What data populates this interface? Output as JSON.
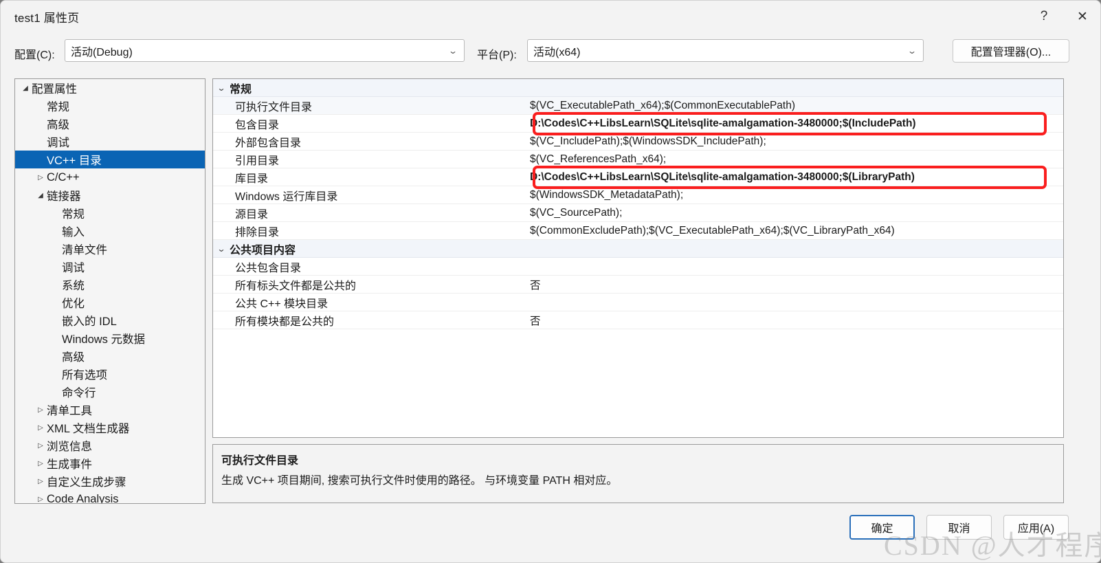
{
  "window": {
    "title": "test1 属性页",
    "help_icon": "?",
    "close_icon": "✕"
  },
  "config_bar": {
    "config_label": "配置(C):",
    "config_value": "活动(Debug)",
    "platform_label": "平台(P):",
    "platform_value": "活动(x64)",
    "config_manager_label": "配置管理器(O)...",
    "chevron": "⌄"
  },
  "tree": {
    "items": [
      {
        "label": "配置属性",
        "indent": 0,
        "twisty": "◢",
        "selected": false
      },
      {
        "label": "常规",
        "indent": 1,
        "twisty": "",
        "selected": false
      },
      {
        "label": "高级",
        "indent": 1,
        "twisty": "",
        "selected": false
      },
      {
        "label": "调试",
        "indent": 1,
        "twisty": "",
        "selected": false
      },
      {
        "label": "VC++ 目录",
        "indent": 1,
        "twisty": "",
        "selected": true
      },
      {
        "label": "C/C++",
        "indent": 1,
        "twisty": "▷",
        "selected": false
      },
      {
        "label": "链接器",
        "indent": 1,
        "twisty": "◢",
        "selected": false
      },
      {
        "label": "常规",
        "indent": 2,
        "twisty": "",
        "selected": false
      },
      {
        "label": "输入",
        "indent": 2,
        "twisty": "",
        "selected": false
      },
      {
        "label": "清单文件",
        "indent": 2,
        "twisty": "",
        "selected": false
      },
      {
        "label": "调试",
        "indent": 2,
        "twisty": "",
        "selected": false
      },
      {
        "label": "系统",
        "indent": 2,
        "twisty": "",
        "selected": false
      },
      {
        "label": "优化",
        "indent": 2,
        "twisty": "",
        "selected": false
      },
      {
        "label": "嵌入的 IDL",
        "indent": 2,
        "twisty": "",
        "selected": false
      },
      {
        "label": "Windows 元数据",
        "indent": 2,
        "twisty": "",
        "selected": false
      },
      {
        "label": "高级",
        "indent": 2,
        "twisty": "",
        "selected": false
      },
      {
        "label": "所有选项",
        "indent": 2,
        "twisty": "",
        "selected": false
      },
      {
        "label": "命令行",
        "indent": 2,
        "twisty": "",
        "selected": false
      },
      {
        "label": "清单工具",
        "indent": 1,
        "twisty": "▷",
        "selected": false
      },
      {
        "label": "XML 文档生成器",
        "indent": 1,
        "twisty": "▷",
        "selected": false
      },
      {
        "label": "浏览信息",
        "indent": 1,
        "twisty": "▷",
        "selected": false
      },
      {
        "label": "生成事件",
        "indent": 1,
        "twisty": "▷",
        "selected": false
      },
      {
        "label": "自定义生成步骤",
        "indent": 1,
        "twisty": "▷",
        "selected": false
      },
      {
        "label": "Code Analysis",
        "indent": 1,
        "twisty": "▷",
        "selected": false
      }
    ]
  },
  "grid": {
    "expander": "⌄",
    "rows": [
      {
        "kind": "category",
        "name": "常规",
        "value": ""
      },
      {
        "kind": "prop",
        "name": "可执行文件目录",
        "value": "$(VC_ExecutablePath_x64);$(CommonExecutablePath)",
        "alt": true,
        "bold": false,
        "highlight": false
      },
      {
        "kind": "prop",
        "name": "包含目录",
        "value": "D:\\Codes\\C++LibsLearn\\SQLite\\sqlite-amalgamation-3480000;$(IncludePath)",
        "alt": false,
        "bold": true,
        "highlight": true
      },
      {
        "kind": "prop",
        "name": "外部包含目录",
        "value": "$(VC_IncludePath);$(WindowsSDK_IncludePath);",
        "alt": false,
        "bold": false,
        "highlight": false
      },
      {
        "kind": "prop",
        "name": "引用目录",
        "value": "$(VC_ReferencesPath_x64);",
        "alt": false,
        "bold": false,
        "highlight": false
      },
      {
        "kind": "prop",
        "name": "库目录",
        "value": "D:\\Codes\\C++LibsLearn\\SQLite\\sqlite-amalgamation-3480000;$(LibraryPath)",
        "alt": false,
        "bold": true,
        "highlight": true
      },
      {
        "kind": "prop",
        "name": "Windows 运行库目录",
        "value": "$(WindowsSDK_MetadataPath);",
        "alt": false,
        "bold": false,
        "highlight": false
      },
      {
        "kind": "prop",
        "name": "源目录",
        "value": "$(VC_SourcePath);",
        "alt": false,
        "bold": false,
        "highlight": false
      },
      {
        "kind": "prop",
        "name": "排除目录",
        "value": "$(CommonExcludePath);$(VC_ExecutablePath_x64);$(VC_LibraryPath_x64)",
        "alt": false,
        "bold": false,
        "highlight": false
      },
      {
        "kind": "category",
        "name": "公共项目内容",
        "value": ""
      },
      {
        "kind": "prop",
        "name": "公共包含目录",
        "value": "",
        "alt": false,
        "bold": false,
        "highlight": false
      },
      {
        "kind": "prop",
        "name": "所有标头文件都是公共的",
        "value": "否",
        "alt": false,
        "bold": false,
        "highlight": false
      },
      {
        "kind": "prop",
        "name": "公共 C++ 模块目录",
        "value": "",
        "alt": false,
        "bold": false,
        "highlight": false
      },
      {
        "kind": "prop",
        "name": "所有模块都是公共的",
        "value": "否",
        "alt": false,
        "bold": false,
        "highlight": false
      }
    ]
  },
  "description": {
    "title": "可执行文件目录",
    "body": "生成 VC++ 项目期间, 搜索可执行文件时使用的路径。 与环境变量 PATH 相对应。"
  },
  "footer": {
    "ok": "确定",
    "cancel": "取消",
    "apply": "应用(A)"
  },
  "watermark": "CSDN @人才程序员",
  "colors": {
    "selection_blue": "#0a64b4",
    "highlight_red": "#fa1e1e",
    "ok_border_blue": "#2a6fba",
    "window_bg": "#f3f3f3",
    "grid_bg": "#ffffff",
    "category_bg": "#f2f5fa"
  }
}
